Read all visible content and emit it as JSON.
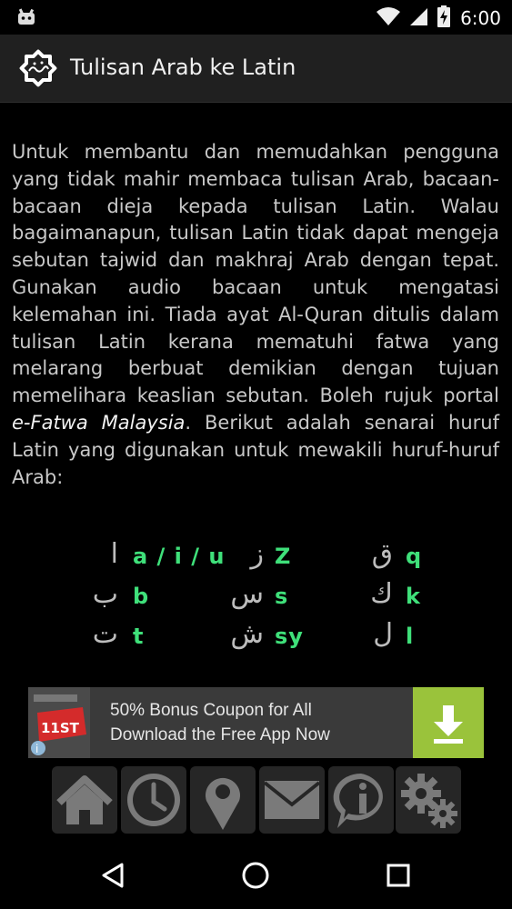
{
  "status_bar": {
    "time": "6:00",
    "icons": [
      "android-icon",
      "wifi-icon",
      "signal-icon",
      "battery-charging-icon"
    ]
  },
  "app_bar": {
    "title": "Tulisan Arab ke Latin",
    "logo_icon": "solat-octagram-logo"
  },
  "content": {
    "text_before_link": "Untuk membantu dan memudahkan pengguna yang tidak mahir membaca tulisan Arab, bacaan-bacaan dieja kepada tulisan Latin. Walau bagaimanapun, tulisan Latin tidak dapat mengeja sebutan tajwid dan makhraj Arab dengan tepat. Gunakan audio bacaan untuk mengatasi kelemahan ini. Tiada ayat Al-Quran ditulis dalam tulisan Latin kerana mematuhi fatwa yang melarang berbuat demikian dengan tujuan memelihara keaslian sebutan. Boleh rujuk portal ",
    "link_text": "e-Fatwa Malaysia",
    "text_after_link": ". Berikut adalah senarai huruf Latin yang digunakan untuk mewakili huruf-huruf Arab:"
  },
  "letters": [
    {
      "arabic": "ا",
      "latin": "a / i / u"
    },
    {
      "arabic": "ب",
      "latin": "b"
    },
    {
      "arabic": "ت",
      "latin": "t"
    },
    {
      "arabic": "ز",
      "latin": "Z"
    },
    {
      "arabic": "س",
      "latin": "s"
    },
    {
      "arabic": "ش",
      "latin": "sy"
    },
    {
      "arabic": "ق",
      "latin": "q"
    },
    {
      "arabic": "ك",
      "latin": "k"
    },
    {
      "arabic": "ل",
      "latin": "l"
    }
  ],
  "ad": {
    "line1": "50% Bonus Coupon for All",
    "line2": "Download the Free App Now",
    "thumb_brand": "11ST",
    "accent": "#9ac33b"
  },
  "bottom_nav": [
    "home-icon",
    "clock-icon",
    "location-pin-icon",
    "mail-icon",
    "info-icon",
    "settings-icon"
  ],
  "system_nav": [
    "back-icon",
    "home-circle-icon",
    "recents-icon"
  ]
}
